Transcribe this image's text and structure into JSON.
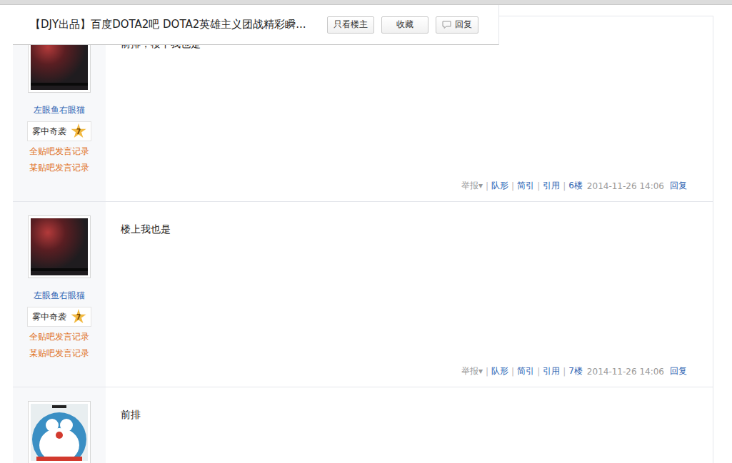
{
  "header": {
    "title": "【DJY出品】百度DOTA2吧 DOTA2英雄主义团战精彩瞬...",
    "buttons": [
      {
        "label": "只看楼主",
        "kind": "plain"
      },
      {
        "label": "收藏",
        "kind": "plain"
      },
      {
        "label": "回复",
        "kind": "comment"
      }
    ]
  },
  "footer_labels": {
    "report": "举报",
    "report_arrow": "▾",
    "actions": [
      "队形",
      "简引",
      "引用"
    ],
    "separator": "|",
    "reply": "回复"
  },
  "posts": [
    {
      "avatar_kind": "photo",
      "author": "左眼鱼右眼猫",
      "badge": {
        "name": "雾中奇袭",
        "level": "7"
      },
      "links": [
        "全贴吧发言记录",
        "某贴吧发言记录"
      ],
      "content": "前排，楼下我也是",
      "floor": "6楼",
      "time": "2014-11-26 14:06"
    },
    {
      "avatar_kind": "photo",
      "author": "左眼鱼右眼猫",
      "badge": {
        "name": "雾中奇袭",
        "level": "7"
      },
      "links": [
        "全贴吧发言记录",
        "某贴吧发言记录"
      ],
      "content": "楼上我也是",
      "floor": "7楼",
      "time": "2014-11-26 14:06"
    },
    {
      "avatar_kind": "cartoon",
      "content": "前排"
    }
  ]
}
